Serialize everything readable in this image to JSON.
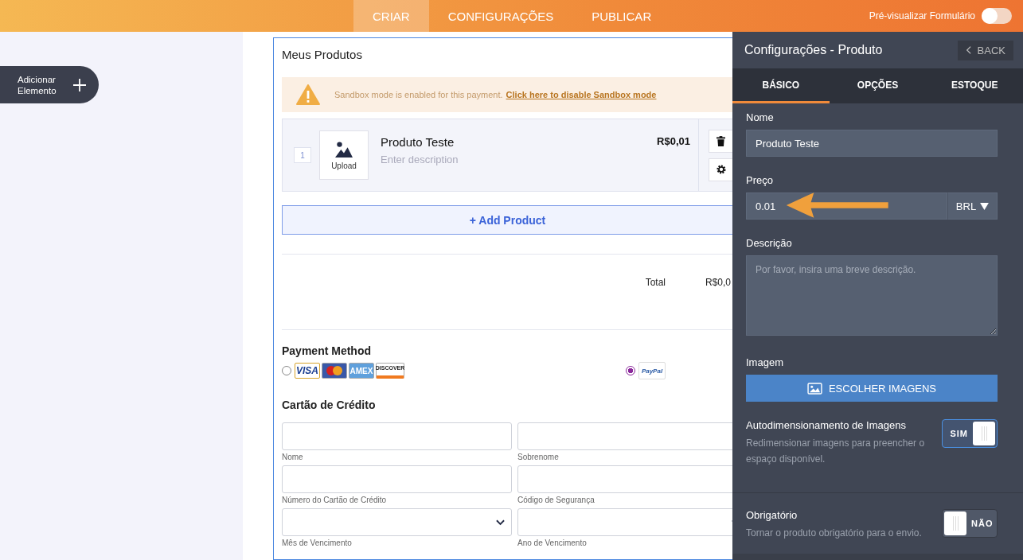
{
  "top_nav": {
    "tabs": [
      {
        "label": "CRIAR",
        "selected": true
      },
      {
        "label": "CONFIGURAÇÕES",
        "selected": false
      },
      {
        "label": "PUBLICAR",
        "selected": false
      }
    ],
    "preview": {
      "label": "Pré-visualizar Formulário",
      "on": false
    }
  },
  "sidebar": {
    "add_element": "Adicionar Elemento"
  },
  "form": {
    "title": "Meus Produtos",
    "notice": {
      "text": "Sandbox mode is enabled for this payment.",
      "link": "Click here to disable Sandbox mode"
    },
    "products": [
      {
        "index": "1",
        "upload": "Upload",
        "name": "Produto Teste",
        "description_placeholder": "Enter description",
        "price": "R$0,01"
      }
    ],
    "add_product": "+ Add Product",
    "total": {
      "label": "Total",
      "value": "R$0,0"
    },
    "payment": {
      "title": "Payment Method",
      "options": [
        {
          "kind": "cards",
          "selected": false,
          "logos": [
            {
              "kind": "visa",
              "label": "VISA"
            },
            {
              "kind": "mastercard"
            },
            {
              "kind": "amex",
              "label": "AMEX"
            },
            {
              "kind": "discover",
              "label": "DISCOVER"
            }
          ]
        },
        {
          "kind": "paypal",
          "selected": true,
          "logos": [
            {
              "kind": "paypal",
              "label": "PayPal"
            }
          ]
        }
      ]
    },
    "card_section": {
      "title": "Cartão de Crédito",
      "fields": [
        {
          "kind": "text",
          "label": "Nome"
        },
        {
          "kind": "text",
          "label": "Sobrenome"
        },
        {
          "kind": "text",
          "label": "Número do Cartão de Crédito"
        },
        {
          "kind": "text",
          "label": "Código de Segurança"
        },
        {
          "kind": "select",
          "label": "Mês de Vencimento"
        },
        {
          "kind": "select",
          "label": "Ano de Vencimento"
        }
      ]
    }
  },
  "panel": {
    "title": "Configurações - Produto",
    "back": "BACK",
    "tabs": [
      {
        "label": "BÁSICO",
        "selected": true
      },
      {
        "label": "OPÇÕES",
        "selected": false
      },
      {
        "label": "ESTOQUE",
        "selected": false
      }
    ],
    "name": {
      "label": "Nome",
      "value": "Produto Teste"
    },
    "price": {
      "label": "Preço",
      "value": "0.01",
      "currency": "BRL"
    },
    "description": {
      "label": "Descrição",
      "placeholder": "Por favor, insira uma breve descrição."
    },
    "image": {
      "label": "Imagem",
      "button": "ESCOLHER IMAGENS"
    },
    "settings": [
      {
        "title": "Autodimensionamento de Imagens",
        "hint": "Redimensionar imagens para preencher o espaço disponível.",
        "on": true,
        "label": "SIM"
      },
      {
        "title": "Obrigatório",
        "hint": "Tornar o produto obrigatório para o envio.",
        "on": false,
        "label": "NÃO"
      }
    ]
  }
}
